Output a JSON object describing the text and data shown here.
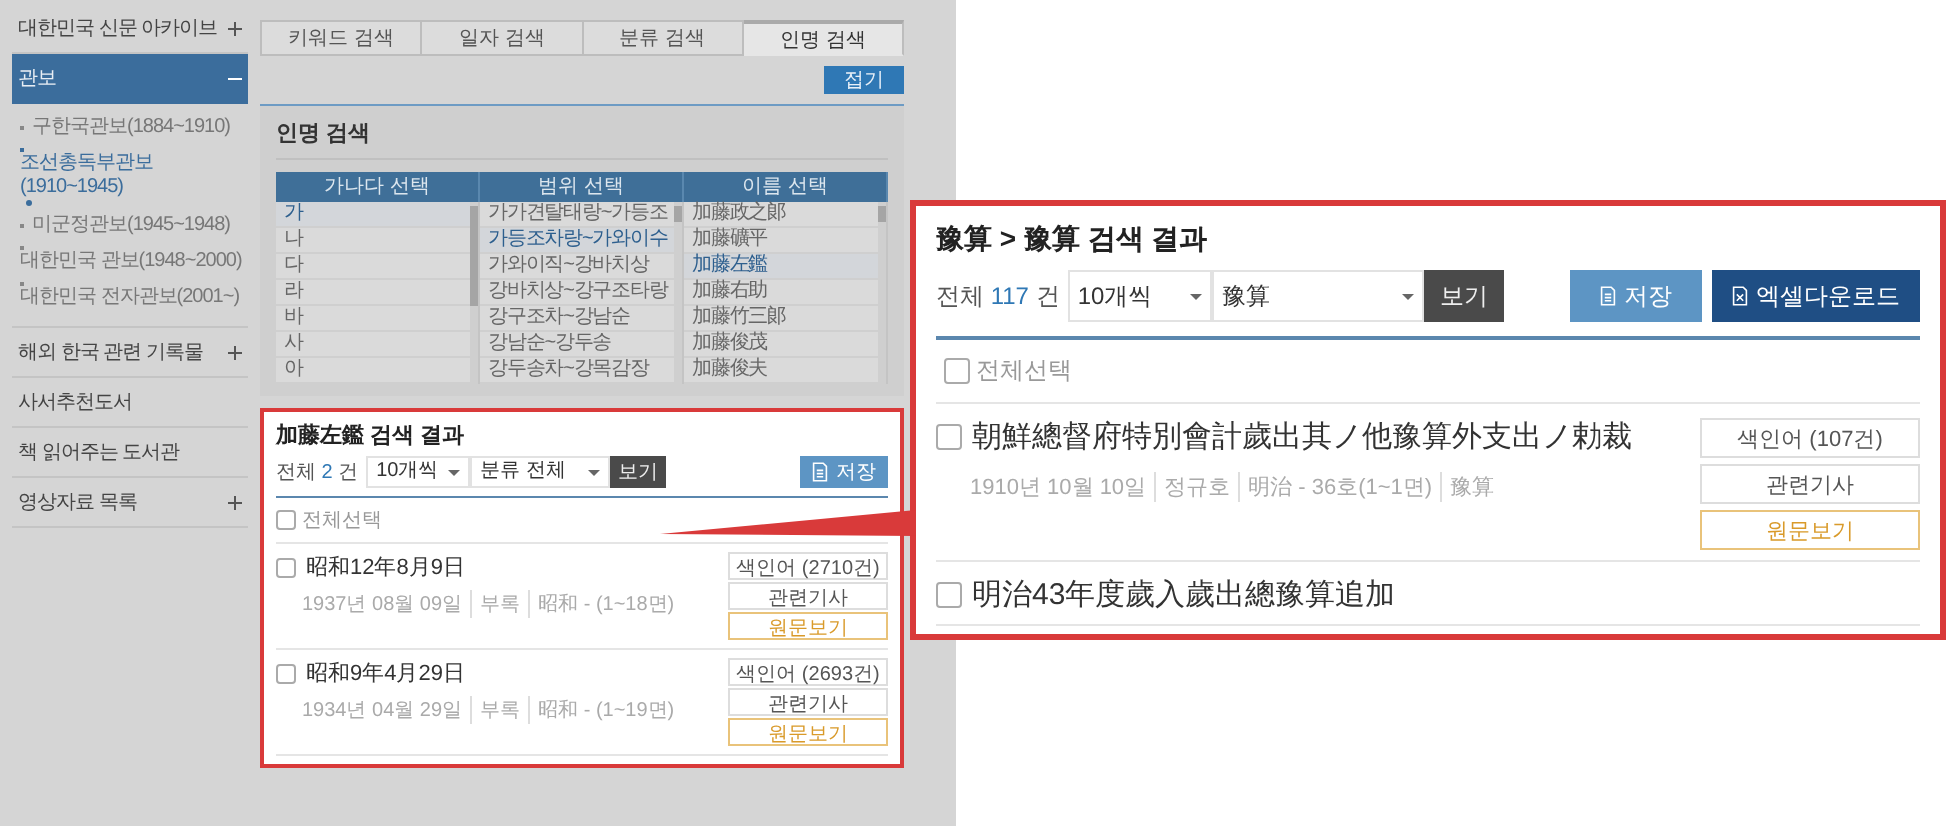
{
  "sidebar": {
    "items": [
      {
        "label": "대한민국 신문 아카이브",
        "kind": "group",
        "expanded": false,
        "selected": false
      },
      {
        "label": "관보",
        "kind": "group",
        "expanded": true,
        "selected": true,
        "children": [
          {
            "label": "구한국관보(1884~1910)",
            "selected": false
          },
          {
            "label": "조선총독부관보(1910~1945)",
            "selected": true
          },
          {
            "label": "미군정관보(1945~1948)",
            "selected": false
          },
          {
            "label": "대한민국 관보(1948~2000)",
            "selected": false
          },
          {
            "label": "대한민국 전자관보(2001~)",
            "selected": false
          }
        ]
      },
      {
        "label": "해외 한국 관련 기록물",
        "kind": "group",
        "expanded": false,
        "selected": false
      },
      {
        "label": "사서추천도서",
        "kind": "link",
        "selected": false
      },
      {
        "label": "책 읽어주는 도서관",
        "kind": "link",
        "selected": false
      },
      {
        "label": "영상자료 목록",
        "kind": "group",
        "expanded": false,
        "selected": false
      }
    ]
  },
  "tabs": [
    {
      "label": "키워드 검색",
      "selected": false
    },
    {
      "label": "일자 검색",
      "selected": false
    },
    {
      "label": "분류 검색",
      "selected": false
    },
    {
      "label": "인명 검색",
      "selected": true
    }
  ],
  "collapse_button": "접기",
  "name_search": {
    "title": "인명 검색",
    "columns": [
      {
        "header": "가나다 선택",
        "items": [
          {
            "label": "가",
            "selected": true
          },
          {
            "label": "나",
            "selected": false
          },
          {
            "label": "다",
            "selected": false
          },
          {
            "label": "라",
            "selected": false
          },
          {
            "label": "바",
            "selected": false
          },
          {
            "label": "사",
            "selected": false
          },
          {
            "label": "아",
            "selected": false
          }
        ]
      },
      {
        "header": "범위 선택",
        "items": [
          {
            "label": "가가견탈태랑~가등조",
            "selected": false
          },
          {
            "label": "가등조차랑~가와이수",
            "selected": true
          },
          {
            "label": "가와이직~강바치상",
            "selected": false
          },
          {
            "label": "강바치상~강구조타랑",
            "selected": false
          },
          {
            "label": "강구조차~강남순",
            "selected": false
          },
          {
            "label": "강남순~강두송",
            "selected": false
          },
          {
            "label": "강두송차~강목감장",
            "selected": false
          }
        ]
      },
      {
        "header": "이름 선택",
        "items": [
          {
            "label": "加藤政之郞",
            "selected": false
          },
          {
            "label": "加藤礦平",
            "selected": false
          },
          {
            "label": "加藤左鑑",
            "selected": true
          },
          {
            "label": "加藤右助",
            "selected": false
          },
          {
            "label": "加藤竹三郞",
            "selected": false
          },
          {
            "label": "加藤俊茂",
            "selected": false
          },
          {
            "label": "加藤俊夫",
            "selected": false
          }
        ]
      }
    ]
  },
  "results": {
    "title": "加藤左鑑 검색 결과",
    "total_label": "전체",
    "count": "2",
    "count_unit": "건",
    "per_page": "10개씩",
    "filter": "분류 전체",
    "view_button": "보기",
    "save_button": "저장",
    "select_all": {
      "label": "전체선택",
      "checked": false
    },
    "items": [
      {
        "title": "昭和12年8月9日",
        "checked": false,
        "meta": [
          "1937년 08월 09일",
          "부록",
          "昭和 - (1~18면)"
        ],
        "buttons": [
          {
            "label": "색인어 (2710건)",
            "kind": "index"
          },
          {
            "label": "관련기사",
            "kind": "related"
          },
          {
            "label": "원문보기",
            "kind": "original"
          }
        ]
      },
      {
        "title": "昭和9年4月29日",
        "checked": false,
        "meta": [
          "1934년 04월 29일",
          "부록",
          "昭和 - (1~19면)"
        ],
        "buttons": [
          {
            "label": "색인어 (2693건)",
            "kind": "index"
          },
          {
            "label": "관련기사",
            "kind": "related"
          },
          {
            "label": "원문보기",
            "kind": "original"
          }
        ]
      }
    ]
  },
  "callout": {
    "title": "豫算 > 豫算 검색 결과",
    "total_label": "전체",
    "count": "117",
    "count_unit": "건",
    "per_page": "10개씩",
    "filter": "豫算",
    "view_button": "보기",
    "save_button": "저장",
    "download_button": "엑셀다운로드",
    "select_all": {
      "label": "전체선택",
      "checked": false
    },
    "items": [
      {
        "title": "朝鮮總督府特別會計歲出其ノ他豫算外支出ノ勅裁",
        "checked": false,
        "meta": [
          "1910년 10월 10일",
          "정규호",
          "明治 - 36호(1~1면)",
          "豫算"
        ],
        "buttons": [
          {
            "label": "색인어 (107건)",
            "kind": "index"
          },
          {
            "label": "관련기사",
            "kind": "related"
          },
          {
            "label": "원문보기",
            "kind": "original"
          }
        ]
      },
      {
        "title": "明治43年度歲入歲出總豫算追加",
        "checked": false
      }
    ]
  }
}
